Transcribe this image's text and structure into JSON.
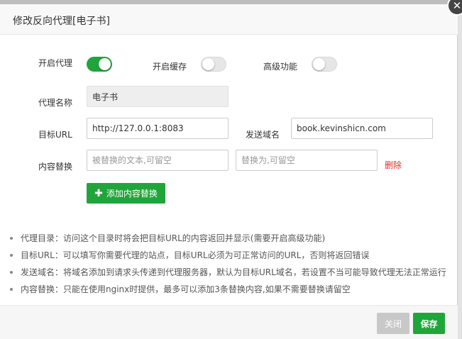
{
  "dialog": {
    "title": "修改反向代理[电子书]",
    "close_glyph": "✕"
  },
  "toggles": {
    "proxy": {
      "label": "开启代理",
      "on": true
    },
    "cache": {
      "label": "开启缓存",
      "on": false
    },
    "advanced": {
      "label": "高级功能",
      "on": false
    }
  },
  "form": {
    "proxy_name": {
      "label": "代理名称",
      "value": "电子书"
    },
    "target_url": {
      "label": "目标URL",
      "value": "http://127.0.0.1:8083"
    },
    "send_domain": {
      "label": "发送域名",
      "value": "book.kevinshicn.com"
    },
    "content_replace": {
      "label": "内容替换",
      "from_placeholder": "被替换的文本,可留空",
      "to_placeholder": "替换为,可留空",
      "delete_label": "删除"
    },
    "add_button_label": "添加内容替换"
  },
  "notes": [
    "代理目录：访问这个目录时将会把目标URL的内容返回并显示(需要开启高级功能)",
    "目标URL：可以填写你需要代理的站点，目标URL必须为可正常访问的URL，否则将返回错误",
    "发送域名：将域名添加到请求头传递到代理服务器，默认为目标URL域名，若设置不当可能导致代理无法正常运行",
    "内容替换：只能在使用nginx时提供，最多可以添加3条替换内容,如果不需要替换请留空"
  ],
  "footer": {
    "close_label": "关闭",
    "save_label": "保存"
  },
  "colors": {
    "accent": "#20a53a",
    "danger": "#e62e2e",
    "disabled": "#c8c8c8"
  }
}
